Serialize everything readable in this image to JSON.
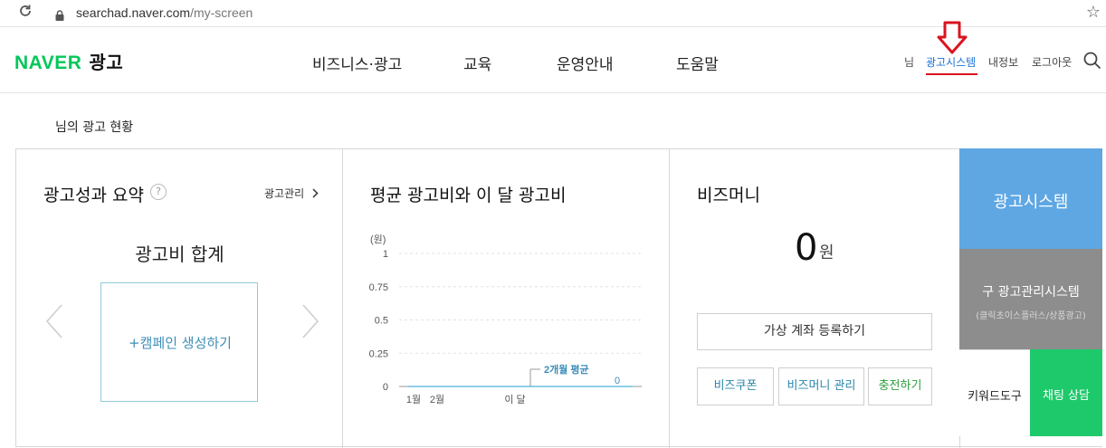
{
  "browser": {
    "url_host": "searchad.naver.com",
    "url_path": "/my-screen"
  },
  "header": {
    "logo_text": "NAVER",
    "logo_ad": "광고",
    "nav": [
      "비즈니스·광고",
      "교육",
      "운영안내",
      "도움말"
    ],
    "user_suffix": "님",
    "ad_system_link": "광고시스템",
    "my_info": "내정보",
    "logout": "로그아웃"
  },
  "page": {
    "subtitle": "님의 광고 현황"
  },
  "summary_panel": {
    "title": "광고성과 요약",
    "help": "?",
    "manage_link": "광고관리",
    "sum_label": "광고비 합계",
    "create_campaign": "+캠페인 생성하기"
  },
  "chart_panel": {
    "title": "평균 광고비와 이 달 광고비"
  },
  "chart_data": {
    "type": "line",
    "title": "평균 광고비와 이 달 광고비",
    "ylabel": "(원)",
    "ylim": [
      0,
      1
    ],
    "yticks": [
      "1",
      "0.75",
      "0.5",
      "0.25",
      "0"
    ],
    "x": [
      "1월",
      "2월",
      "이 달"
    ],
    "series": [
      {
        "values": [
          0,
          0,
          0
        ]
      }
    ],
    "annotations": [
      "2개월 평균",
      "0"
    ],
    "grid": true
  },
  "bizmoney_panel": {
    "title": "비즈머니",
    "amount": "0",
    "unit": "원",
    "register_account": "가상 계좌 등록하기",
    "coupon": "비즈쿠폰",
    "manage": "비즈머니 관리",
    "charge": "충전하기"
  },
  "side": {
    "ad_system": "광고시스템",
    "old_system": "구 광고관리시스템",
    "old_system_sub": "(클릭초이스플러스/상품광고)",
    "keyword_tool": "키워드도구",
    "chat": "채팅 상담"
  },
  "colors": {
    "naver_green": "#03c75a",
    "ad_system_blue": "#5ea7e3",
    "old_system_gray": "#8d8d8d",
    "chat_green": "#1ec96b",
    "annotation_red": "#d8151f"
  }
}
